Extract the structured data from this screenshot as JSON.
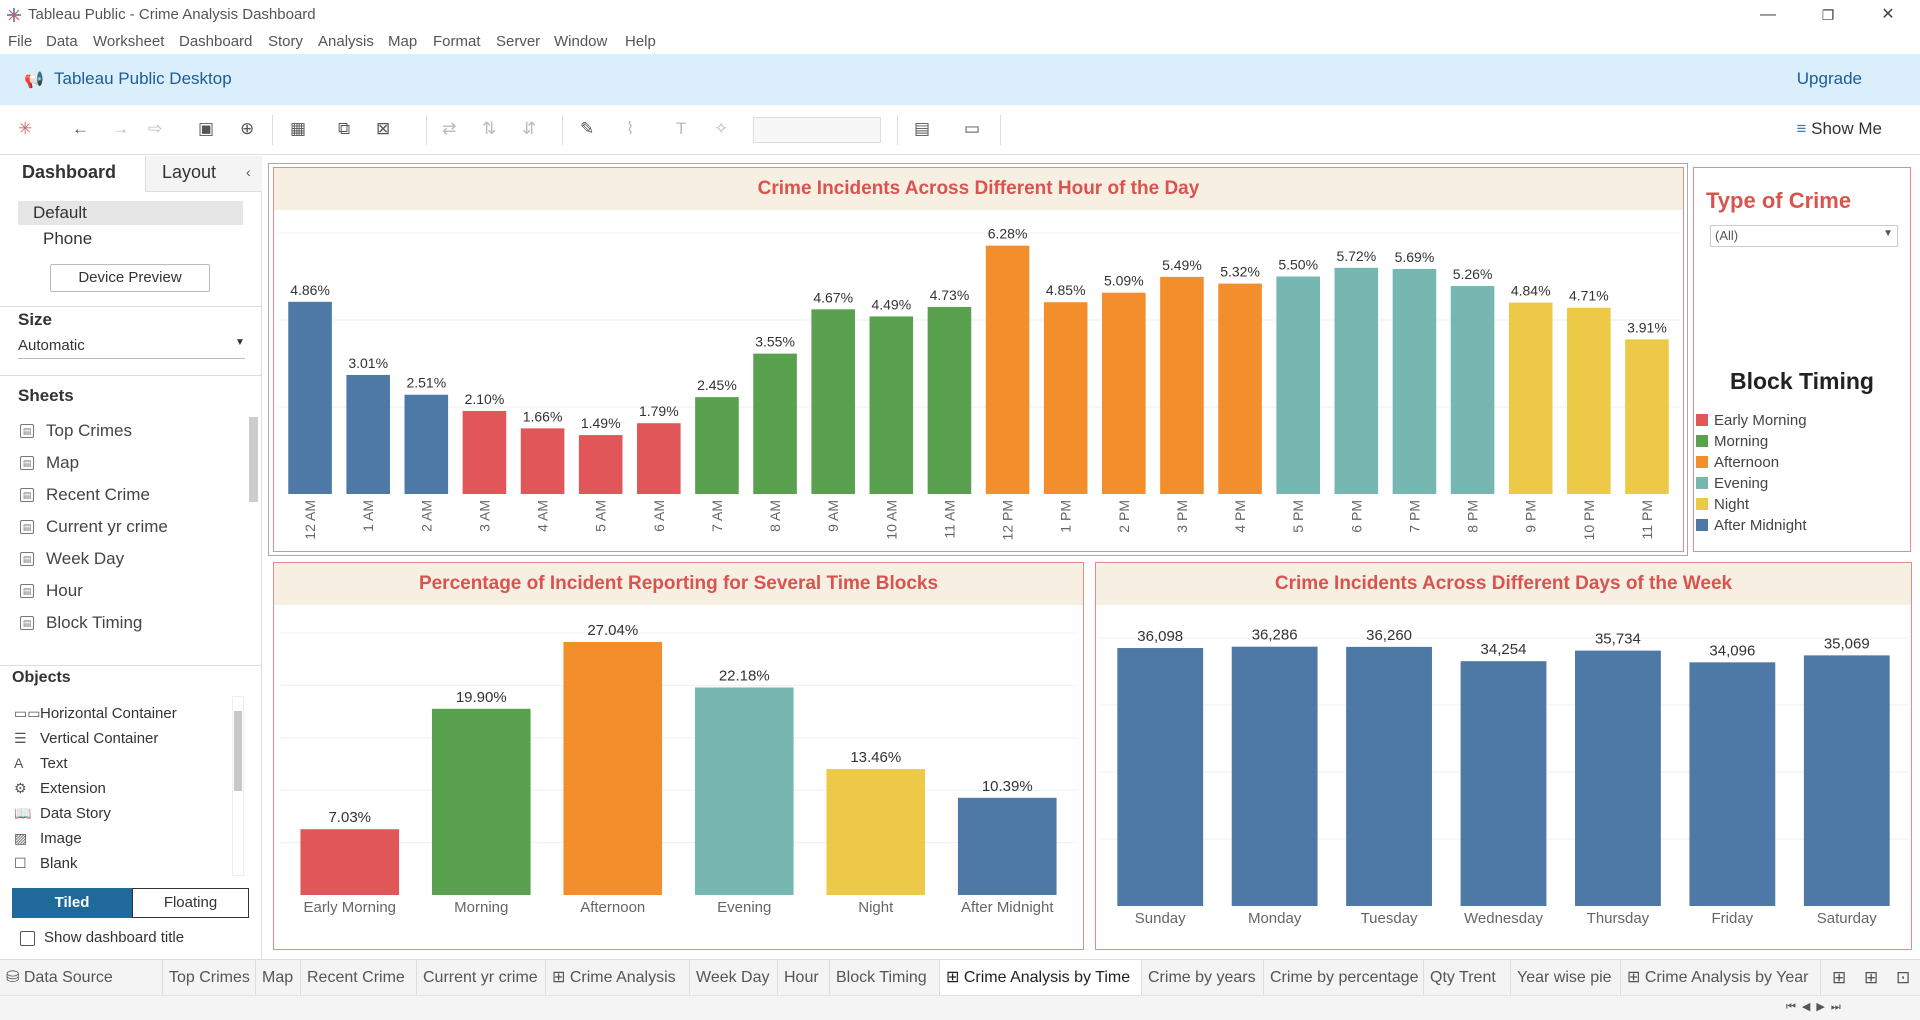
{
  "window": {
    "title": "Tableau Public - Crime Analysis Dashboard",
    "minimize": "—",
    "maximize": "❐",
    "close": "✕"
  },
  "menu": [
    "File",
    "Data",
    "Worksheet",
    "Dashboard",
    "Story",
    "Analysis",
    "Map",
    "Format",
    "Server",
    "Window",
    "Help"
  ],
  "banner": {
    "product": "Tableau Public Desktop",
    "upgrade": "Upgrade"
  },
  "toolbar": {
    "show_me": "Show Me"
  },
  "left_panel": {
    "tabs": [
      "Dashboard",
      "Layout"
    ],
    "devices": [
      "Default",
      "Phone"
    ],
    "device_preview": "Device Preview",
    "size_label": "Size",
    "size_value": "Automatic",
    "sheets_label": "Sheets",
    "sheets": [
      "Top Crimes",
      "Map",
      "Recent Crime",
      "Current yr crime",
      "Week Day",
      "Hour",
      "Block Timing"
    ],
    "objects_label": "Objects",
    "objects": [
      "Horizontal Container",
      "Vertical Container",
      "Text",
      "Extension",
      "Data Story",
      "Image",
      "Blank"
    ],
    "tiled": "Tiled",
    "floating": "Floating",
    "show_title": "Show dashboard title"
  },
  "legend": {
    "filter_title": "Type of Crime",
    "filter_value": "(All)",
    "title": "Block Timing",
    "items": [
      {
        "label": "Early Morning",
        "color": "#e15759"
      },
      {
        "label": "Morning",
        "color": "#59a14f"
      },
      {
        "label": "Afternoon",
        "color": "#f28e2b"
      },
      {
        "label": "Evening",
        "color": "#76b7b2"
      },
      {
        "label": "Night",
        "color": "#edc948"
      },
      {
        "label": "After Midnight",
        "color": "#4e79a7"
      }
    ]
  },
  "chart_data": [
    {
      "type": "bar",
      "title": "Crime Incidents Across Different Hour of the Day",
      "categories": [
        "12 AM",
        "1 AM",
        "2 AM",
        "3 AM",
        "4 AM",
        "5 AM",
        "6 AM",
        "7 AM",
        "8 AM",
        "9 AM",
        "10 AM",
        "11 AM",
        "12 PM",
        "1 PM",
        "2 PM",
        "3 PM",
        "4 PM",
        "5 PM",
        "6 PM",
        "7 PM",
        "8 PM",
        "9 PM",
        "10 PM",
        "11 PM"
      ],
      "values": [
        4.86,
        3.01,
        2.51,
        2.1,
        1.66,
        1.49,
        1.79,
        2.45,
        3.55,
        4.67,
        4.49,
        4.73,
        6.28,
        4.85,
        5.09,
        5.49,
        5.32,
        5.5,
        5.72,
        5.69,
        5.26,
        4.84,
        4.71,
        3.91
      ],
      "labels": [
        "4.86%",
        "3.01%",
        "2.51%",
        "2.10%",
        "1.66%",
        "1.49%",
        "1.79%",
        "2.45%",
        "3.55%",
        "4.67%",
        "4.49%",
        "4.73%",
        "6.28%",
        "4.85%",
        "5.09%",
        "5.49%",
        "5.32%",
        "5.50%",
        "5.72%",
        "5.69%",
        "5.26%",
        "4.84%",
        "4.71%",
        "3.91%"
      ],
      "colors": [
        "#4e79a7",
        "#4e79a7",
        "#4e79a7",
        "#e15759",
        "#e15759",
        "#e15759",
        "#e15759",
        "#59a14f",
        "#59a14f",
        "#59a14f",
        "#59a14f",
        "#59a14f",
        "#f28e2b",
        "#f28e2b",
        "#f28e2b",
        "#f28e2b",
        "#f28e2b",
        "#76b7b2",
        "#76b7b2",
        "#76b7b2",
        "#76b7b2",
        "#edc948",
        "#edc948",
        "#edc948"
      ],
      "ylim": [
        0,
        6.6
      ],
      "grid": true
    },
    {
      "type": "bar",
      "title": "Percentage of Incident Reporting for Several Time Blocks",
      "categories": [
        "Early Morning",
        "Morning",
        "Afternoon",
        "Evening",
        "Night",
        "After Midnight"
      ],
      "values": [
        7.03,
        19.9,
        27.04,
        22.18,
        13.46,
        10.39
      ],
      "labels": [
        "7.03%",
        "19.90%",
        "27.04%",
        "22.18%",
        "13.46%",
        "10.39%"
      ],
      "colors": [
        "#e15759",
        "#59a14f",
        "#f28e2b",
        "#76b7b2",
        "#edc948",
        "#4e79a7"
      ],
      "ylim": [
        0,
        28
      ],
      "grid": true
    },
    {
      "type": "bar",
      "title": "Crime Incidents Across Different Days of the Week",
      "categories": [
        "Sunday",
        "Monday",
        "Tuesday",
        "Wednesday",
        "Thursday",
        "Friday",
        "Saturday"
      ],
      "values": [
        36098,
        36286,
        36260,
        34254,
        35734,
        34096,
        35069
      ],
      "labels": [
        "36,098",
        "36,286",
        "36,260",
        "34,254",
        "35,734",
        "34,096",
        "35,069"
      ],
      "colors": [
        "#4e79a7",
        "#4e79a7",
        "#4e79a7",
        "#4e79a7",
        "#4e79a7",
        "#4e79a7",
        "#4e79a7"
      ],
      "ylim": [
        0,
        37500
      ],
      "grid": true
    }
  ],
  "tabs": [
    "Data Source",
    "Top Crimes",
    "Map",
    "Recent Crime",
    "Current yr crime",
    "Crime Analysis",
    "Week Day",
    "Hour",
    "Block Timing",
    "Crime Analysis by Time",
    "Crime by years",
    "Crime by percentage",
    "Qty Trent",
    "Year wise pie",
    "Crime Analysis by Year"
  ],
  "active_tab": "Crime Analysis by Time"
}
